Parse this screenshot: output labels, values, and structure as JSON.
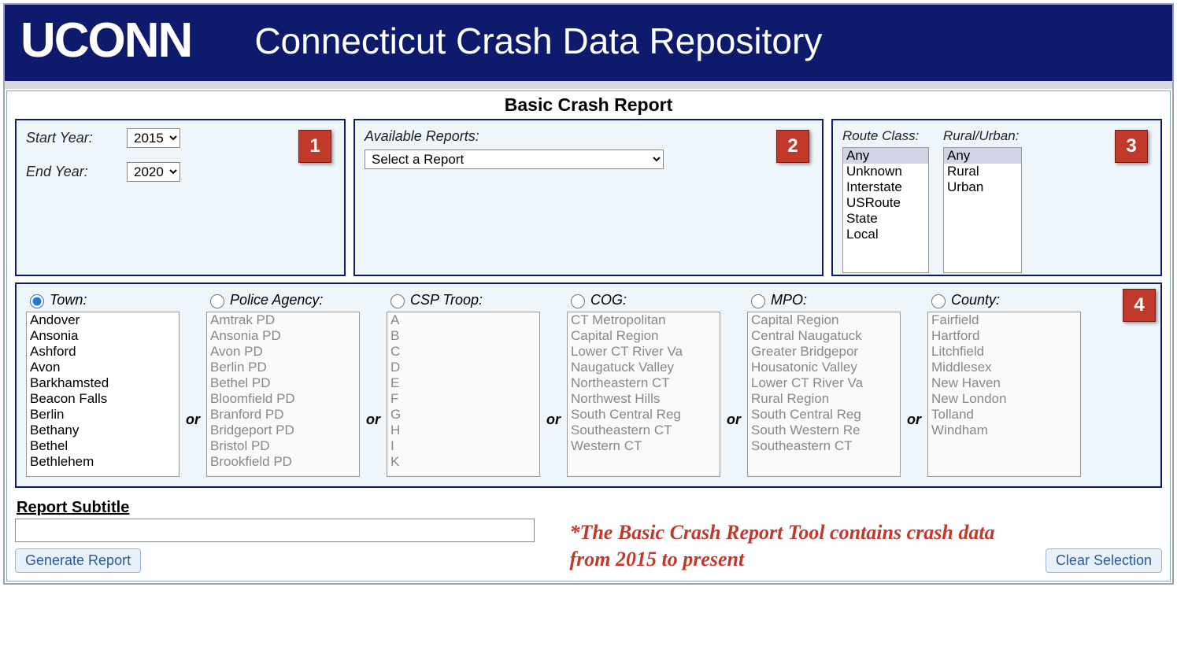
{
  "header": {
    "logo": "UCONN",
    "title": "Connecticut Crash Data Repository"
  },
  "section_title": "Basic Crash Report",
  "panel1": {
    "start_label": "Start Year:",
    "start_value": "2015",
    "end_label": "End Year:",
    "end_value": "2020",
    "badge": "1"
  },
  "panel2": {
    "label": "Available Reports:",
    "select_value": "Select a Report",
    "badge": "2"
  },
  "panel3": {
    "route_label": "Route Class:",
    "route_options": [
      "Any",
      "Unknown",
      "Interstate",
      "USRoute",
      "State",
      "Local"
    ],
    "rural_label": "Rural/Urban:",
    "rural_options": [
      "Any",
      "Rural",
      "Urban"
    ],
    "badge": "3"
  },
  "panel4": {
    "badge": "4",
    "or_text": "or",
    "cols": {
      "town": {
        "label": "Town:",
        "checked": true,
        "options": [
          "Andover",
          "Ansonia",
          "Ashford",
          "Avon",
          "Barkhamsted",
          "Beacon Falls",
          "Berlin",
          "Bethany",
          "Bethel",
          "Bethlehem"
        ]
      },
      "agency": {
        "label": "Police Agency:",
        "checked": false,
        "options": [
          "Amtrak PD",
          "Ansonia PD",
          "Avon PD",
          "Berlin PD",
          "Bethel PD",
          "Bloomfield PD",
          "Branford PD",
          "Bridgeport PD",
          "Bristol PD",
          "Brookfield PD"
        ]
      },
      "csp": {
        "label": "CSP Troop:",
        "checked": false,
        "options": [
          "A",
          "B",
          "C",
          "D",
          "E",
          "F",
          "G",
          "H",
          "I",
          "K"
        ]
      },
      "cog": {
        "label": "COG:",
        "checked": false,
        "options": [
          "CT Metropolitan",
          "Capital Region",
          "Lower CT River Va",
          "Naugatuck Valley",
          "Northeastern CT",
          "Northwest Hills",
          "South Central Reg",
          "Southeastern CT",
          "Western CT"
        ]
      },
      "mpo": {
        "label": "MPO:",
        "checked": false,
        "options": [
          "Capital Region",
          "Central Naugatuck",
          "Greater Bridgepor",
          "Housatonic Valley",
          "Lower CT River Va",
          "Rural Region",
          "South Central Reg",
          "South Western Re",
          "Southeastern CT"
        ]
      },
      "county": {
        "label": "County:",
        "checked": false,
        "options": [
          "Fairfield",
          "Hartford",
          "Litchfield",
          "Middlesex",
          "New Haven",
          "New London",
          "Tolland",
          "Windham"
        ]
      }
    }
  },
  "footer": {
    "subtitle_label": "Report Subtitle",
    "subtitle_value": "",
    "generate_btn": "Generate Report",
    "clear_btn": "Clear Selection",
    "note": "*The Basic Crash Report Tool contains crash data from 2015 to present"
  }
}
